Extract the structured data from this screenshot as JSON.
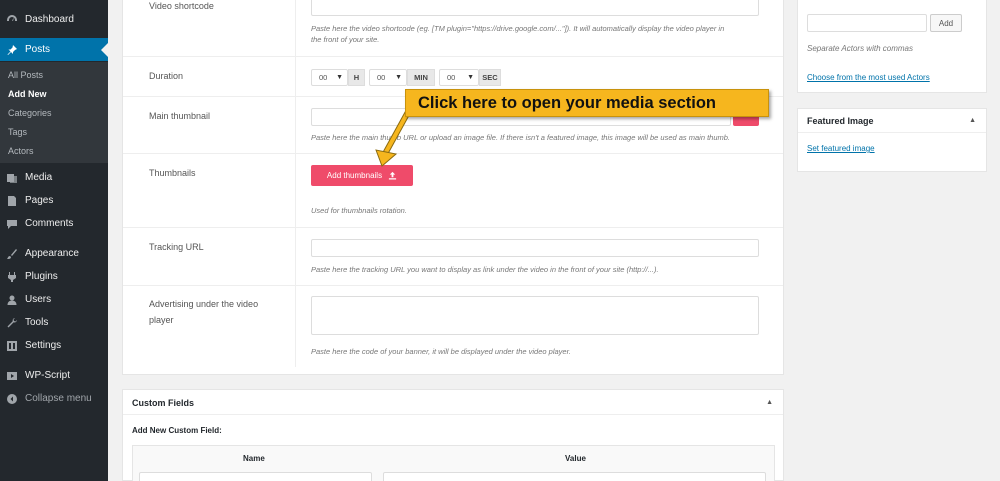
{
  "sidebar": {
    "items": {
      "dashboard": {
        "label": "Dashboard",
        "icon": "dashboard-icon"
      },
      "posts": {
        "label": "Posts",
        "icon": "pin-icon"
      },
      "media": {
        "label": "Media",
        "icon": "media-icon"
      },
      "pages": {
        "label": "Pages",
        "icon": "page-icon"
      },
      "comments": {
        "label": "Comments",
        "icon": "comment-icon"
      },
      "appearance": {
        "label": "Appearance",
        "icon": "brush-icon"
      },
      "plugins": {
        "label": "Plugins",
        "icon": "plug-icon"
      },
      "users": {
        "label": "Users",
        "icon": "user-icon"
      },
      "tools": {
        "label": "Tools",
        "icon": "wrench-icon"
      },
      "settings": {
        "label": "Settings",
        "icon": "settings-icon"
      },
      "wpscript": {
        "label": "WP-Script",
        "icon": "video-icon"
      },
      "collapse": {
        "label": "Collapse menu",
        "icon": "collapse-icon"
      }
    },
    "posts_submenu": {
      "all_posts": "All Posts",
      "add_new": "Add New",
      "categories": "Categories",
      "tags": "Tags",
      "actors": "Actors"
    }
  },
  "form": {
    "video_shortcode": {
      "label": "Video shortcode",
      "help_line1": "Paste here the video shortcode (eg. [TM plugin=\"https://drive.google.com/...\"]). It will automatically display the video player in",
      "help_line2": "the front of your site."
    },
    "duration": {
      "label": "Duration",
      "hours": "00",
      "hours_unit": "H",
      "minutes": "00",
      "minutes_unit": "MIN",
      "seconds": "00",
      "seconds_unit": "SEC"
    },
    "main_thumbnail": {
      "label": "Main thumbnail",
      "help": "Paste here the main thumb URL or upload an image file. If there isn't a featured image, this image will be used as main thumb."
    },
    "thumbnails": {
      "label": "Thumbnails",
      "button": "Add thumbnails",
      "help": "Used for thumbnails rotation."
    },
    "tracking_url": {
      "label": "Tracking URL",
      "help": "Paste here the tracking URL you want to display as link under the video in the front of your site (http://...)."
    },
    "advertising": {
      "label_line1": "Advertising under the video",
      "label_line2": "player",
      "help": "Paste here the code of your banner, it will be displayed under the video player."
    }
  },
  "custom_fields": {
    "title": "Custom Fields",
    "add_new": "Add New Custom Field:",
    "col_name": "Name",
    "col_value": "Value"
  },
  "actors_box": {
    "add_button": "Add",
    "help": "Separate Actors with commas",
    "choose_link": "Choose from the most used Actors"
  },
  "featured_image_box": {
    "title": "Featured Image",
    "link": "Set featured image"
  },
  "callout": {
    "text": "Click here to open your media section"
  },
  "colors": {
    "sidebar_bg": "#23282d",
    "active_blue": "#0073aa",
    "button_pink": "#ef4b6a",
    "callout_yellow": "#f6b61e"
  }
}
